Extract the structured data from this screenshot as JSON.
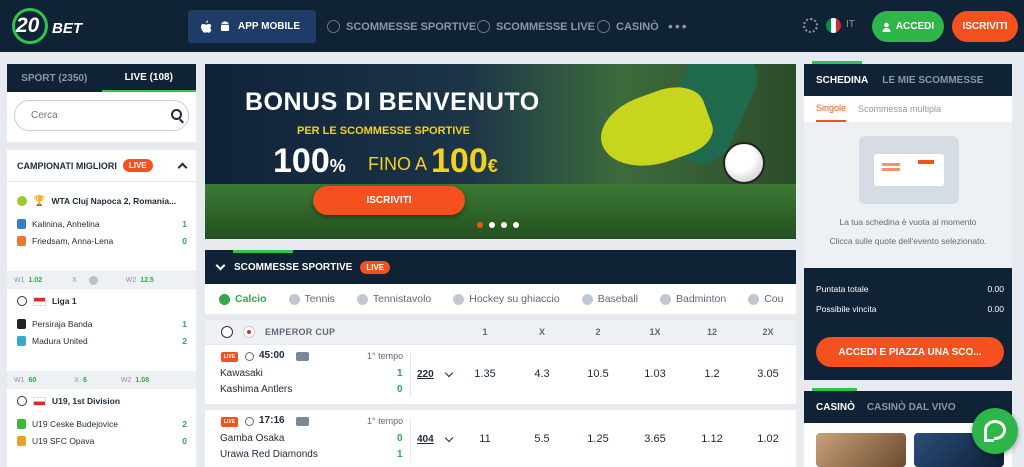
{
  "header": {
    "logo_num": "20",
    "logo_text": "BET",
    "app_mobile": "APP MOBILE",
    "nav": [
      "SCOMMESSE SPORTIVE",
      "SCOMMESSE LIVE",
      "CASINÒ"
    ],
    "more": "•••",
    "lang": "IT",
    "login": "ACCEDI",
    "register": "ISCRIVITI"
  },
  "left": {
    "tab_sport": "SPORT (2350)",
    "tab_live": "LIVE (108)",
    "search_placeholder": "Cerca",
    "champ_title": "CAMPIONATI MIGLIORI",
    "live_badge": "LIVE",
    "leagues": [
      {
        "name": "WTA Cluj Napoca 2, Romania...",
        "teams": [
          {
            "name": "Kalinina, Anhelina",
            "score": "1"
          },
          {
            "name": "Friedsam, Anna-Lena",
            "score": "0"
          }
        ],
        "odds": {
          "l1": "W1",
          "v1": "1.02",
          "l2": "X",
          "l3": "W2",
          "v3": "12.5"
        }
      },
      {
        "name": "Liga 1",
        "teams": [
          {
            "name": "Persiraja Banda",
            "score": "1"
          },
          {
            "name": "Madura United",
            "score": "2"
          }
        ],
        "odds": {
          "l1": "W1",
          "v1": "60",
          "l2": "X",
          "v2": "6",
          "l3": "W2",
          "v3": "1.08"
        }
      },
      {
        "name": "U19, 1st Division",
        "teams": [
          {
            "name": "U19 Ceske Budejovice",
            "score": "2"
          },
          {
            "name": "U19 SFC Opava",
            "score": "0"
          }
        ]
      }
    ]
  },
  "banner": {
    "title": "BONUS DI BENVENUTO",
    "subtitle": "PER LE SCOMMESSE SPORTIVE",
    "pct": "100",
    "pct_sign": "%",
    "upto": "FINO A",
    "amount": "100",
    "currency": "€",
    "cta": "ISCRIVITI"
  },
  "sports": {
    "title": "SCOMMESSE SPORTIVE",
    "live": "LIVE",
    "tabs": [
      "Calcio",
      "Tennis",
      "Tennistavolo",
      "Hockey su ghiaccio",
      "Baseball",
      "Badminton",
      "Cou"
    ],
    "cup": "EMPEROR CUP",
    "cols": [
      "1",
      "X",
      "2",
      "1X",
      "12",
      "2X"
    ],
    "matches": [
      {
        "live": "LIVE",
        "time": "45:00",
        "period": "1° tempo",
        "team1": "Kawasaki",
        "team2": "Kashima Antlers",
        "score1": "1",
        "score2": "0",
        "more": "220",
        "odds": [
          "1.35",
          "4.3",
          "10.5",
          "1.03",
          "1.2",
          "3.05"
        ]
      },
      {
        "live": "LIVE",
        "time": "17:16",
        "period": "1° tempo",
        "team1": "Gamba Osaka",
        "team2": "Urawa Red Diamonds",
        "score1": "0",
        "score2": "1",
        "more": "404",
        "odds": [
          "11",
          "5.5",
          "1.25",
          "3.65",
          "1.12",
          "1.02"
        ]
      }
    ]
  },
  "slip": {
    "tab1": "SCHEDINA",
    "tab2": "LE MIE SCOMMESSE",
    "sub1": "Singole",
    "sub2": "Scommessa multipla",
    "empty": "La tua schedina è vuota al momento",
    "hint": "Clicca sulle quote dell'evento selezionato.",
    "stake_label": "Puntata totale",
    "stake_value": "0.00",
    "win_label": "Possibile vincita",
    "win_value": "0.00",
    "cta": "ACCEDI E PIAZZA UNA SCO..."
  },
  "casino": {
    "tab1": "CASINÒ",
    "tab2": "CASINÒ DAL VIVO"
  },
  "colors": {
    "navy": "#102235",
    "green": "#2eb64a",
    "orange": "#f4511e",
    "yellow": "#f2d21f"
  }
}
